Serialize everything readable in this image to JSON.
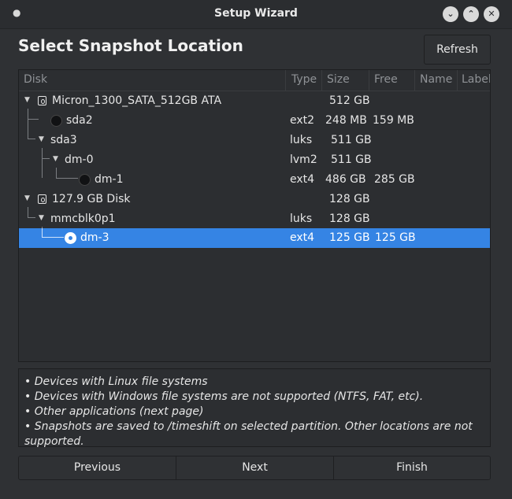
{
  "window": {
    "title": "Setup Wizard",
    "controls": {
      "minimize": "⌄",
      "maximize": "⌃",
      "close": "✕"
    }
  },
  "heading": "Select Snapshot Location",
  "refresh_label": "Refresh",
  "columns": [
    "Disk",
    "Type",
    "Size",
    "Free",
    "Name",
    "Label"
  ],
  "rows": [
    {
      "name": "Micron_1300_SATA_512GB ATA",
      "type": "",
      "size": "512 GB",
      "free": ""
    },
    {
      "name": "sda2",
      "type": "ext2",
      "size": "248 MB",
      "free": "159 MB"
    },
    {
      "name": "sda3",
      "type": "luks",
      "size": "511 GB",
      "free": ""
    },
    {
      "name": "dm-0",
      "type": "lvm2",
      "size": "511 GB",
      "free": ""
    },
    {
      "name": "dm-1",
      "type": "ext4",
      "size": "486 GB",
      "free": "285 GB"
    },
    {
      "name": "127.9 GB Disk",
      "type": "",
      "size": "128 GB",
      "free": ""
    },
    {
      "name": "mmcblk0p1",
      "type": "luks",
      "size": "128 GB",
      "free": ""
    },
    {
      "name": "dm-3",
      "type": "ext4",
      "size": "125 GB",
      "free": "125 GB"
    }
  ],
  "notes": [
    "• Devices with Linux file systems",
    "• Devices with Windows file systems are not supported (NTFS, FAT, etc).",
    "• Other applications (next page)",
    "• Snapshots are saved to /timeshift on selected partition. Other locations are not",
    "supported."
  ],
  "nav": {
    "previous": "Previous",
    "next": "Next",
    "finish": "Finish"
  },
  "accent_color": "#3584e4"
}
